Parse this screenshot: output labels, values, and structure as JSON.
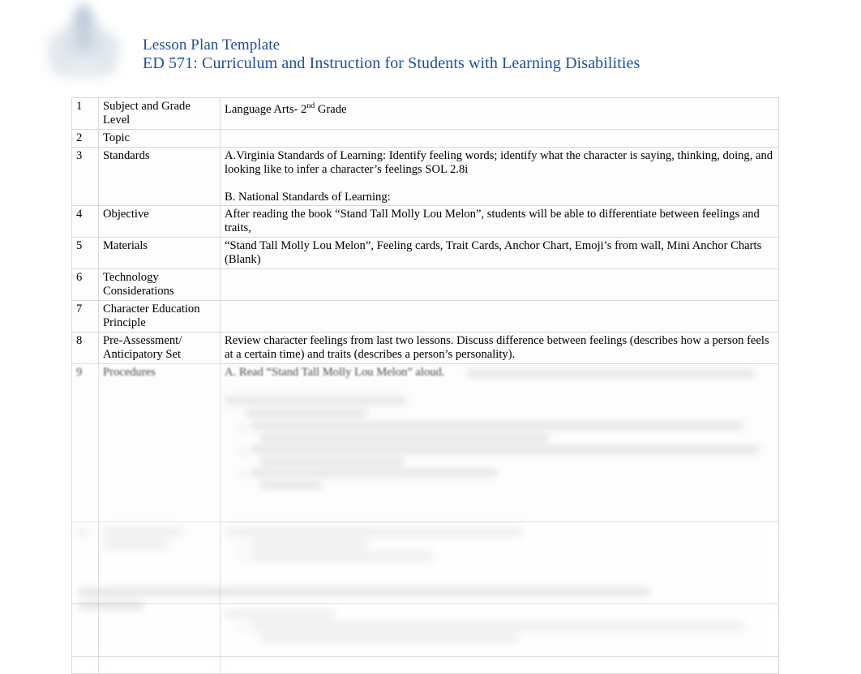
{
  "header": {
    "logo_alt": "university-seal-logo",
    "title_line_1": "Lesson Plan Template",
    "title_line_2": "ED 571: Curriculum and Instruction for Students with Learning Disabilities",
    "title_color": "#1F4E9C"
  },
  "table": {
    "rows": [
      {
        "number": "1",
        "label": "Subject and Grade Level",
        "body_prefix": "Language Arts- 2",
        "body_sup": "nd",
        "body_suffix": " Grade",
        "legible": true
      },
      {
        "number": "2",
        "label": "Topic",
        "body": "",
        "legible": true
      },
      {
        "number": "3",
        "label": "Standards",
        "body_a": "A.Virginia Standards of Learning: Identify feeling words; identify what the character is saying, thinking, doing, and looking like to infer a character’s feelings SOL 2.8i",
        "body_b": "B. National Standards of Learning:",
        "legible": true
      },
      {
        "number": "4",
        "label": "Objective",
        "body": "After reading the book “Stand Tall Molly Lou Melon”, students will be able to differentiate between feelings and traits,",
        "legible": true
      },
      {
        "number": "5",
        "label": "Materials",
        "body": "“Stand Tall Molly Lou Melon”, Feeling cards, Trait Cards, Anchor Chart, Emoji’s from wall, Mini Anchor Charts (Blank)",
        "legible": true
      },
      {
        "number": "6",
        "label": "Technology Considerations",
        "body": "",
        "legible": true
      },
      {
        "number": "7",
        "label": "Character Education Principle",
        "body": "",
        "legible": true
      },
      {
        "number": "8",
        "label": "Pre-Assessment/ Anticipatory Set",
        "body": "Review character feelings from last two lessons.  Discuss difference between feelings (describes how a person feels at a certain time) and traits (describes a person’s personality).",
        "legible": true
      },
      {
        "number": "9",
        "label": "Procedures",
        "body": "A. Read “Stand Tall Molly Lou Melon” aloud.",
        "legible": true,
        "note": "row begins to fade; remaining content illegible"
      }
    ],
    "illegible_note": "Content below row 9 is blurred/redacted and not readable in the screenshot."
  },
  "footer": {
    "note": "Footer line is blurred and illegible in the screenshot."
  }
}
